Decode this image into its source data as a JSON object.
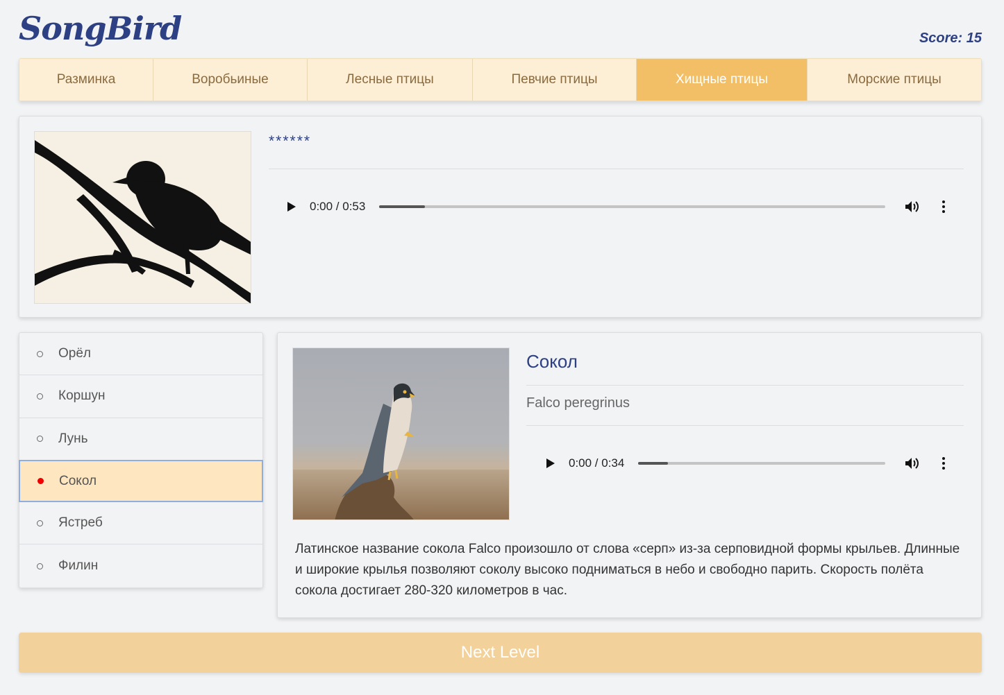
{
  "app": {
    "logo": "SongBird",
    "score_label": "Score: 15"
  },
  "tabs": [
    {
      "label": "Разминка",
      "active": false
    },
    {
      "label": "Воробьиные",
      "active": false
    },
    {
      "label": "Лесные птицы",
      "active": false
    },
    {
      "label": "Певчие птицы",
      "active": false
    },
    {
      "label": "Хищные птицы",
      "active": true
    },
    {
      "label": "Морские птицы",
      "active": false
    }
  ],
  "question": {
    "masked_name": "******",
    "image_icon": "bird-silhouette",
    "audio": {
      "time": "0:00 / 0:53",
      "progress": 0.09
    }
  },
  "answers": [
    {
      "label": "Орёл",
      "selected": false
    },
    {
      "label": "Коршун",
      "selected": false
    },
    {
      "label": "Лунь",
      "selected": false
    },
    {
      "label": "Сокол",
      "selected": true
    },
    {
      "label": "Ястреб",
      "selected": false
    },
    {
      "label": "Филин",
      "selected": false
    }
  ],
  "details": {
    "name": "Сокол",
    "latin": "Falco peregrinus",
    "image_icon": "falcon-photo",
    "audio": {
      "time": "0:00 / 0:34",
      "progress": 0.12
    },
    "description": "Латинское название сокола Falco произошло от слова «серп» из-за серповидной формы крыльев. Длинные и широкие крылья позволяют соколу высоко подниматься в небо и свободно парить. Скорость полёта сокола достигает 280-320 километров в час."
  },
  "next_button": {
    "label": "Next Level"
  },
  "colors": {
    "brand": "#2d4083",
    "tab_active": "#f3bf66",
    "tab_bg": "#fdefd6",
    "selected_bg": "#fde6c0",
    "next_button": "#f2d19b",
    "selected_dot": "#e00000"
  }
}
